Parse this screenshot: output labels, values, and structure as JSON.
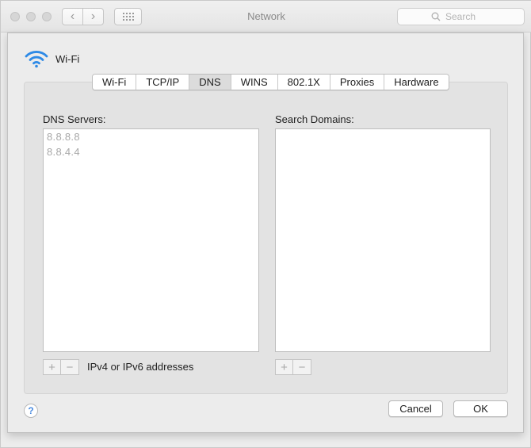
{
  "window": {
    "title": "Network"
  },
  "search": {
    "placeholder": "Search"
  },
  "interface": {
    "name": "Wi-Fi"
  },
  "tabs": [
    {
      "label": "Wi-Fi"
    },
    {
      "label": "TCP/IP"
    },
    {
      "label": "DNS",
      "active": true
    },
    {
      "label": "WINS"
    },
    {
      "label": "802.1X"
    },
    {
      "label": "Proxies"
    },
    {
      "label": "Hardware"
    }
  ],
  "dns": {
    "label": "DNS Servers:",
    "servers": [
      "8.8.8.8",
      "8.8.4.4"
    ],
    "hint": "IPv4 or IPv6 addresses"
  },
  "domains": {
    "label": "Search Domains:",
    "items": []
  },
  "controls": {
    "add": "+",
    "remove": "−",
    "help": "?"
  },
  "buttons": {
    "cancel": "Cancel",
    "ok": "OK"
  },
  "colors": {
    "accent": "#2e8ae6",
    "disabled_text": "#a8a8a8"
  }
}
